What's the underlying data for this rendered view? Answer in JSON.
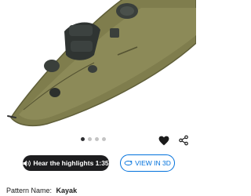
{
  "product": {
    "image_alt": "kayak-product-image",
    "hull_color": "#7f7d4d",
    "carousel": {
      "total": 4,
      "active": 0
    }
  },
  "actions": {
    "favorite_icon": "heart-icon",
    "share_icon": "share-icon"
  },
  "highlights_button": {
    "label": "Hear the highlights 1:35",
    "icon": "speaker-icon"
  },
  "view3d_button": {
    "label": "VIEW IN 3D",
    "icon": "3d-rotate-icon",
    "color": "#0071dc"
  },
  "pattern": {
    "label": "Pattern Name:",
    "value": "Kayak"
  }
}
